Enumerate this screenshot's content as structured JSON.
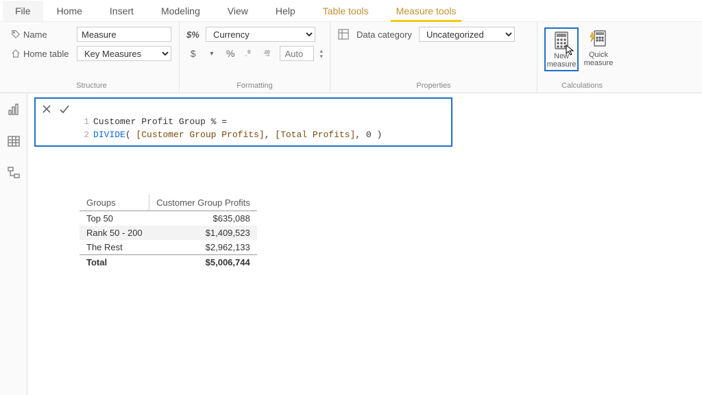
{
  "menu": {
    "file": "File",
    "home": "Home",
    "insert": "Insert",
    "modeling": "Modeling",
    "view": "View",
    "help": "Help",
    "table_tools": "Table tools",
    "measure_tools": "Measure tools"
  },
  "ribbon": {
    "structure": {
      "group_label": "Structure",
      "name_label": "Name",
      "name_value": "Measure",
      "home_table_label": "Home table",
      "home_table_value": "Key Measures"
    },
    "formatting": {
      "group_label": "Formatting",
      "format_label": "$%",
      "format_value": "Currency",
      "dollar": "$",
      "percent": "%",
      "comma": ",",
      "decimals": ".00",
      "moredec": ".0",
      "auto_placeholder": "Auto"
    },
    "properties": {
      "group_label": "Properties",
      "data_category_label": "Data category",
      "data_category_value": "Uncategorized"
    },
    "calculations": {
      "group_label": "Calculations",
      "new_measure": "New measure",
      "quick_measure": "Quick measure"
    }
  },
  "formula": {
    "line1_num": "1",
    "line1_text": "Customer Profit Group % =",
    "line2_num": "2",
    "line2_func": "DIVIDE",
    "line2_open": "( ",
    "line2_arg1": "[Customer Group Profits]",
    "line2_sep1": ", ",
    "line2_arg2": "[Total Profits]",
    "line2_sep2": ", 0 ",
    "line2_close": ")"
  },
  "table": {
    "headers": {
      "col1": "Groups",
      "col2": "Customer Group Profits"
    },
    "rows": [
      {
        "group": "Top 50",
        "value": "$635,088"
      },
      {
        "group": "Rank 50 - 200",
        "value": "$1,409,523"
      },
      {
        "group": "The Rest",
        "value": "$2,962,133"
      }
    ],
    "total": {
      "label": "Total",
      "value": "$5,006,744"
    }
  }
}
